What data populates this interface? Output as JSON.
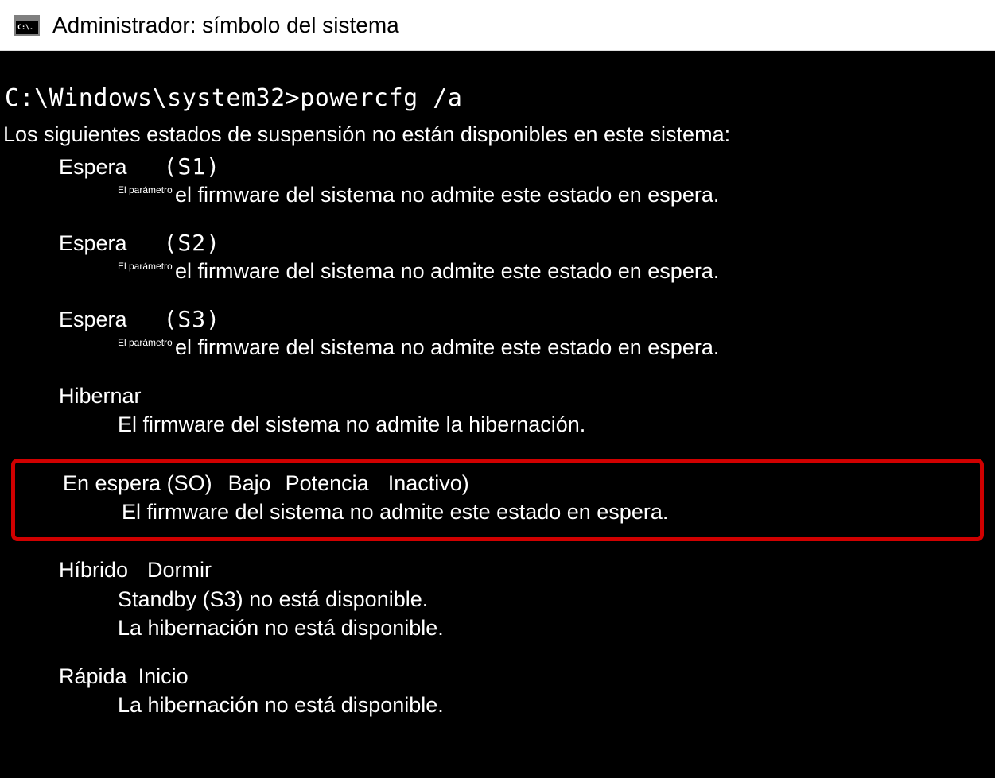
{
  "window": {
    "icon_label": "C:\\.",
    "title": "Administrador: símbolo del sistema"
  },
  "terminal": {
    "prompt": "C:\\Windows\\system32>powercfg /a",
    "intro": "Los siguientes estados de suspensión no están disponibles en este sistema:",
    "prefix_small": "El parámetro",
    "states": {
      "s1": {
        "name": "Espera",
        "code": "(S1)",
        "desc": "el firmware del sistema no admite este estado en espera."
      },
      "s2": {
        "name": "Espera",
        "code": "(S2)",
        "desc": "el firmware del sistema no admite este estado en espera."
      },
      "s3": {
        "name": "Espera",
        "code": "(S3)",
        "desc": "el firmware del sistema no admite este estado en espera."
      },
      "hibernate": {
        "name": "Hibernar",
        "desc": "El firmware del sistema no admite la hibernación."
      },
      "s0": {
        "name_part1": "En espera (SO)",
        "name_part2": "Bajo",
        "name_part3": "Potencia",
        "name_part4": "Inactivo)",
        "desc": "El firmware del sistema no admite este estado en espera."
      },
      "hybrid": {
        "name_part1": "Híbrido",
        "name_part2": "Dormir",
        "desc1": "Standby (S3) no está disponible.",
        "desc2": "La hibernación no está disponible."
      },
      "fast": {
        "name_part1": "Rápida",
        "name_part2": "Inicio",
        "desc": "La hibernación no está disponible."
      }
    }
  }
}
